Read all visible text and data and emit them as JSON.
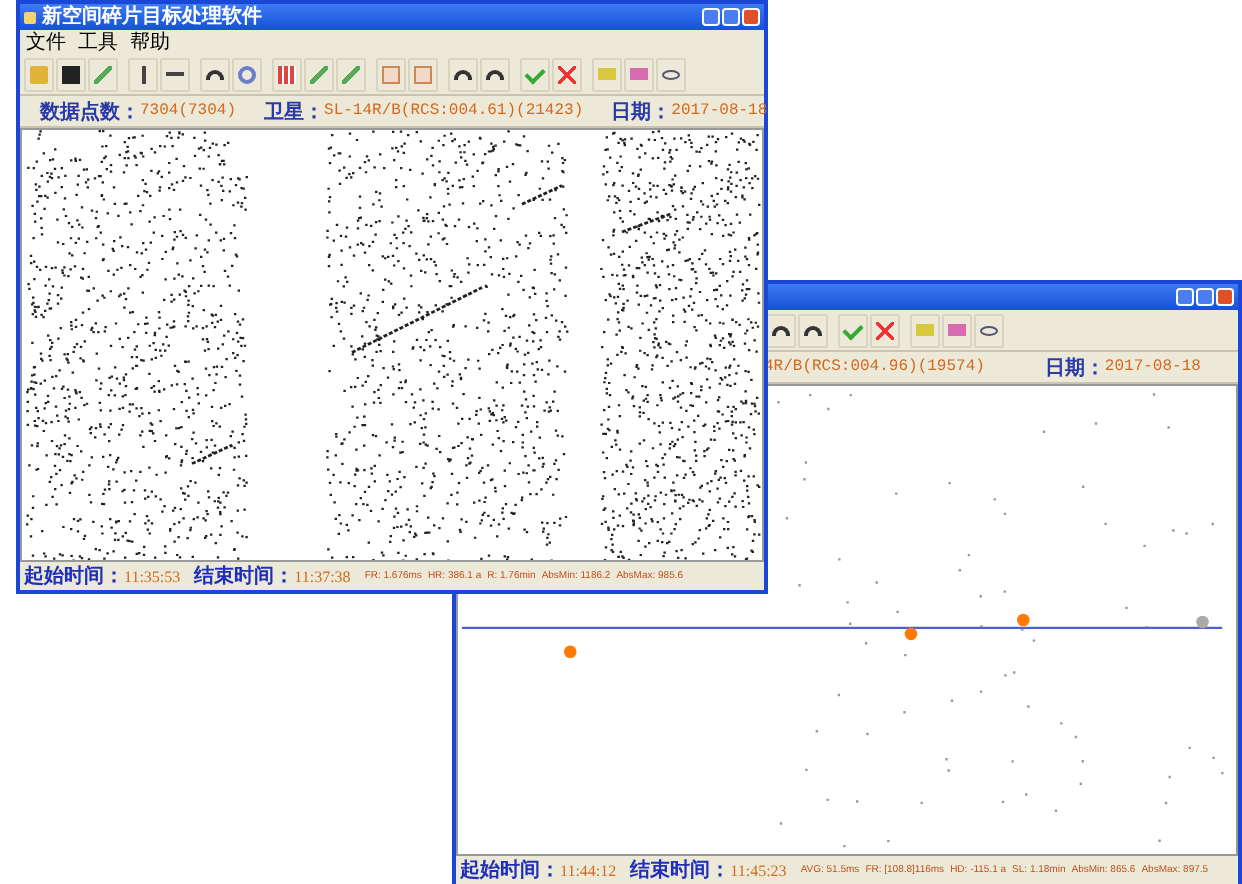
{
  "front_window": {
    "title": "新空间碎片目标处理软件",
    "menu": [
      "文件",
      "工具",
      "帮助"
    ],
    "info": [
      {
        "label": "数据点数：",
        "value": "7304(7304)"
      },
      {
        "label": "卫星：",
        "value": "SL-14R/B(RCS:004.61)(21423)"
      },
      {
        "label": "日期：",
        "value": "2017-08-18"
      }
    ],
    "status": [
      {
        "label": "起始时间：",
        "value": "11:35:53"
      },
      {
        "label": "结束时间：",
        "value": "11:37:38"
      }
    ],
    "stats": [
      "FR: 1.676ms",
      "HR: 386.1 a",
      "R: 1.76min",
      "AbsMin: 1186.2",
      "AbsMax: 985.6"
    ]
  },
  "back_window": {
    "info": [
      {
        "value": "4R/B(RCS:004.96)(19574)"
      },
      {
        "label": "日期：",
        "value": "2017-08-18"
      }
    ],
    "status": [
      {
        "label": "起始时间：",
        "value": "11:44:12"
      },
      {
        "label": "结束时间：",
        "value": "11:45:23"
      }
    ],
    "stats": [
      "AVG: 51.5ms",
      "FR: [108.8]116ms",
      "HD: -115.1 a",
      "SL: 1.18min",
      "AbsMin: 865.6",
      "AbsMax: 897.5"
    ]
  }
}
